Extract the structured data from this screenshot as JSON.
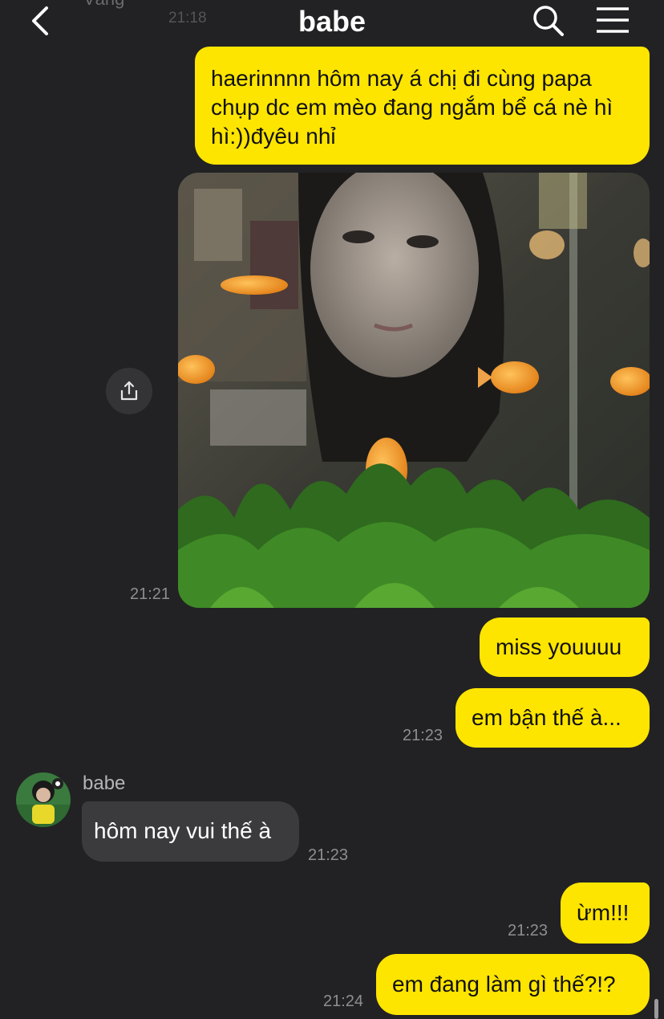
{
  "header": {
    "title": "babe",
    "prev_sender": "Vâng",
    "prev_time": "21:18"
  },
  "messages": {
    "m1": {
      "text": "haerinnnn hôm nay á chị đi cùng papa chụp dc em mèo đang ngắm bể cá nè hì hì:))đyêu nhỉ"
    },
    "m2": {
      "time": "21:21"
    },
    "m3": {
      "text": "miss youuuu"
    },
    "m4": {
      "text": "em bận thế à...",
      "time": "21:23"
    },
    "m5": {
      "sender": "babe",
      "text": "hôm nay vui thế à",
      "time": "21:23"
    },
    "m6": {
      "text": "ừm!!!",
      "time": "21:23"
    },
    "m7": {
      "text": "em đang làm gì thế?!?",
      "time": "21:24"
    }
  },
  "icons": {
    "back": "chevron-left-icon",
    "search": "search-icon",
    "menu": "hamburger-menu-icon",
    "share": "share-icon"
  },
  "colors": {
    "background": "#222224",
    "my_bubble": "#FEE500",
    "their_bubble": "#3b3b3d"
  }
}
